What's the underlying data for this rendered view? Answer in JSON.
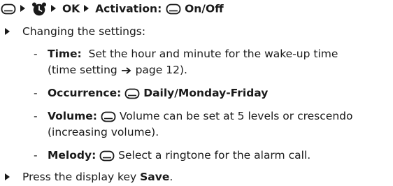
{
  "header": {
    "ok": "OK",
    "activation_label": "Activation:",
    "onoff": "On/Off"
  },
  "items": {
    "changing": "Changing the settings:",
    "time_label": "Time:",
    "time_text_1": "Set the hour and minute for the wake-up time",
    "time_text_2_a": "(time setting ",
    "time_text_2_b": " page 12).",
    "occurrence_label": "Occurrence:",
    "occurrence_value": "Daily/Monday-Friday",
    "volume_label": "Volume:",
    "volume_text_1": "Volume can be set at 5 levels or crescendo",
    "volume_text_2": "(increasing volume).",
    "melody_label": "Melody:",
    "melody_text": "Select a ringtone for the alarm call.",
    "press_prefix": "Press the display key ",
    "press_key": "Save",
    "press_suffix": "."
  },
  "icons": [
    "menu-key-icon",
    "alarm-clock-icon",
    "control-key-icon",
    "arrow-right-icon"
  ]
}
